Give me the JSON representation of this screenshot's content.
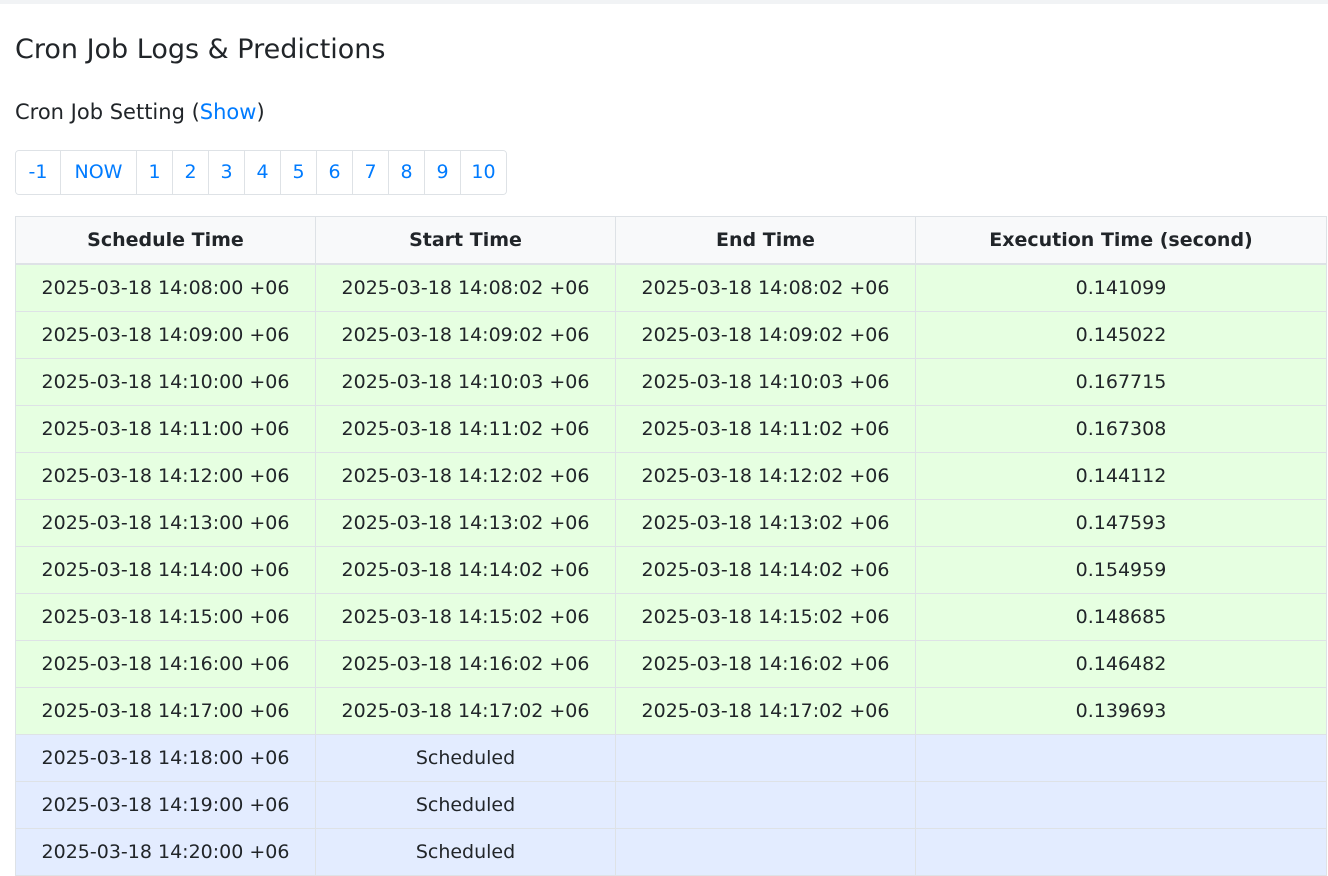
{
  "page": {
    "title": "Cron Job Logs & Predictions",
    "setting_prefix": "Cron Job Setting (",
    "setting_link": "Show",
    "setting_suffix": ")"
  },
  "pagination": {
    "items": [
      {
        "label": "-1",
        "active": false
      },
      {
        "label": "NOW",
        "active": true
      },
      {
        "label": "1",
        "active": false
      },
      {
        "label": "2",
        "active": false
      },
      {
        "label": "3",
        "active": false
      },
      {
        "label": "4",
        "active": false
      },
      {
        "label": "5",
        "active": false
      },
      {
        "label": "6",
        "active": false
      },
      {
        "label": "7",
        "active": false
      },
      {
        "label": "8",
        "active": false
      },
      {
        "label": "9",
        "active": false
      },
      {
        "label": "10",
        "active": false
      }
    ]
  },
  "table": {
    "headers": [
      "Schedule Time",
      "Start Time",
      "End Time",
      "Execution Time (second)"
    ],
    "rows": [
      {
        "status": "done",
        "cells": [
          "2025-03-18 14:08:00 +06",
          "2025-03-18 14:08:02 +06",
          "2025-03-18 14:08:02 +06",
          "0.141099"
        ]
      },
      {
        "status": "done",
        "cells": [
          "2025-03-18 14:09:00 +06",
          "2025-03-18 14:09:02 +06",
          "2025-03-18 14:09:02 +06",
          "0.145022"
        ]
      },
      {
        "status": "done",
        "cells": [
          "2025-03-18 14:10:00 +06",
          "2025-03-18 14:10:03 +06",
          "2025-03-18 14:10:03 +06",
          "0.167715"
        ]
      },
      {
        "status": "done",
        "cells": [
          "2025-03-18 14:11:00 +06",
          "2025-03-18 14:11:02 +06",
          "2025-03-18 14:11:02 +06",
          "0.167308"
        ]
      },
      {
        "status": "done",
        "cells": [
          "2025-03-18 14:12:00 +06",
          "2025-03-18 14:12:02 +06",
          "2025-03-18 14:12:02 +06",
          "0.144112"
        ]
      },
      {
        "status": "done",
        "cells": [
          "2025-03-18 14:13:00 +06",
          "2025-03-18 14:13:02 +06",
          "2025-03-18 14:13:02 +06",
          "0.147593"
        ]
      },
      {
        "status": "done",
        "cells": [
          "2025-03-18 14:14:00 +06",
          "2025-03-18 14:14:02 +06",
          "2025-03-18 14:14:02 +06",
          "0.154959"
        ]
      },
      {
        "status": "done",
        "cells": [
          "2025-03-18 14:15:00 +06",
          "2025-03-18 14:15:02 +06",
          "2025-03-18 14:15:02 +06",
          "0.148685"
        ]
      },
      {
        "status": "done",
        "cells": [
          "2025-03-18 14:16:00 +06",
          "2025-03-18 14:16:02 +06",
          "2025-03-18 14:16:02 +06",
          "0.146482"
        ]
      },
      {
        "status": "done",
        "cells": [
          "2025-03-18 14:17:00 +06",
          "2025-03-18 14:17:02 +06",
          "2025-03-18 14:17:02 +06",
          "0.139693"
        ]
      },
      {
        "status": "scheduled",
        "cells": [
          "2025-03-18 14:18:00 +06",
          "Scheduled",
          "",
          ""
        ]
      },
      {
        "status": "scheduled",
        "cells": [
          "2025-03-18 14:19:00 +06",
          "Scheduled",
          "",
          ""
        ]
      },
      {
        "status": "scheduled",
        "cells": [
          "2025-03-18 14:20:00 +06",
          "Scheduled",
          "",
          ""
        ]
      }
    ]
  },
  "colors": {
    "accent": "#007bff",
    "done_row": "#e6ffe1",
    "scheduled_row": "#e3ecff",
    "header_bg": "#f8f9fa",
    "border": "#dee2e6",
    "text": "#212529"
  }
}
